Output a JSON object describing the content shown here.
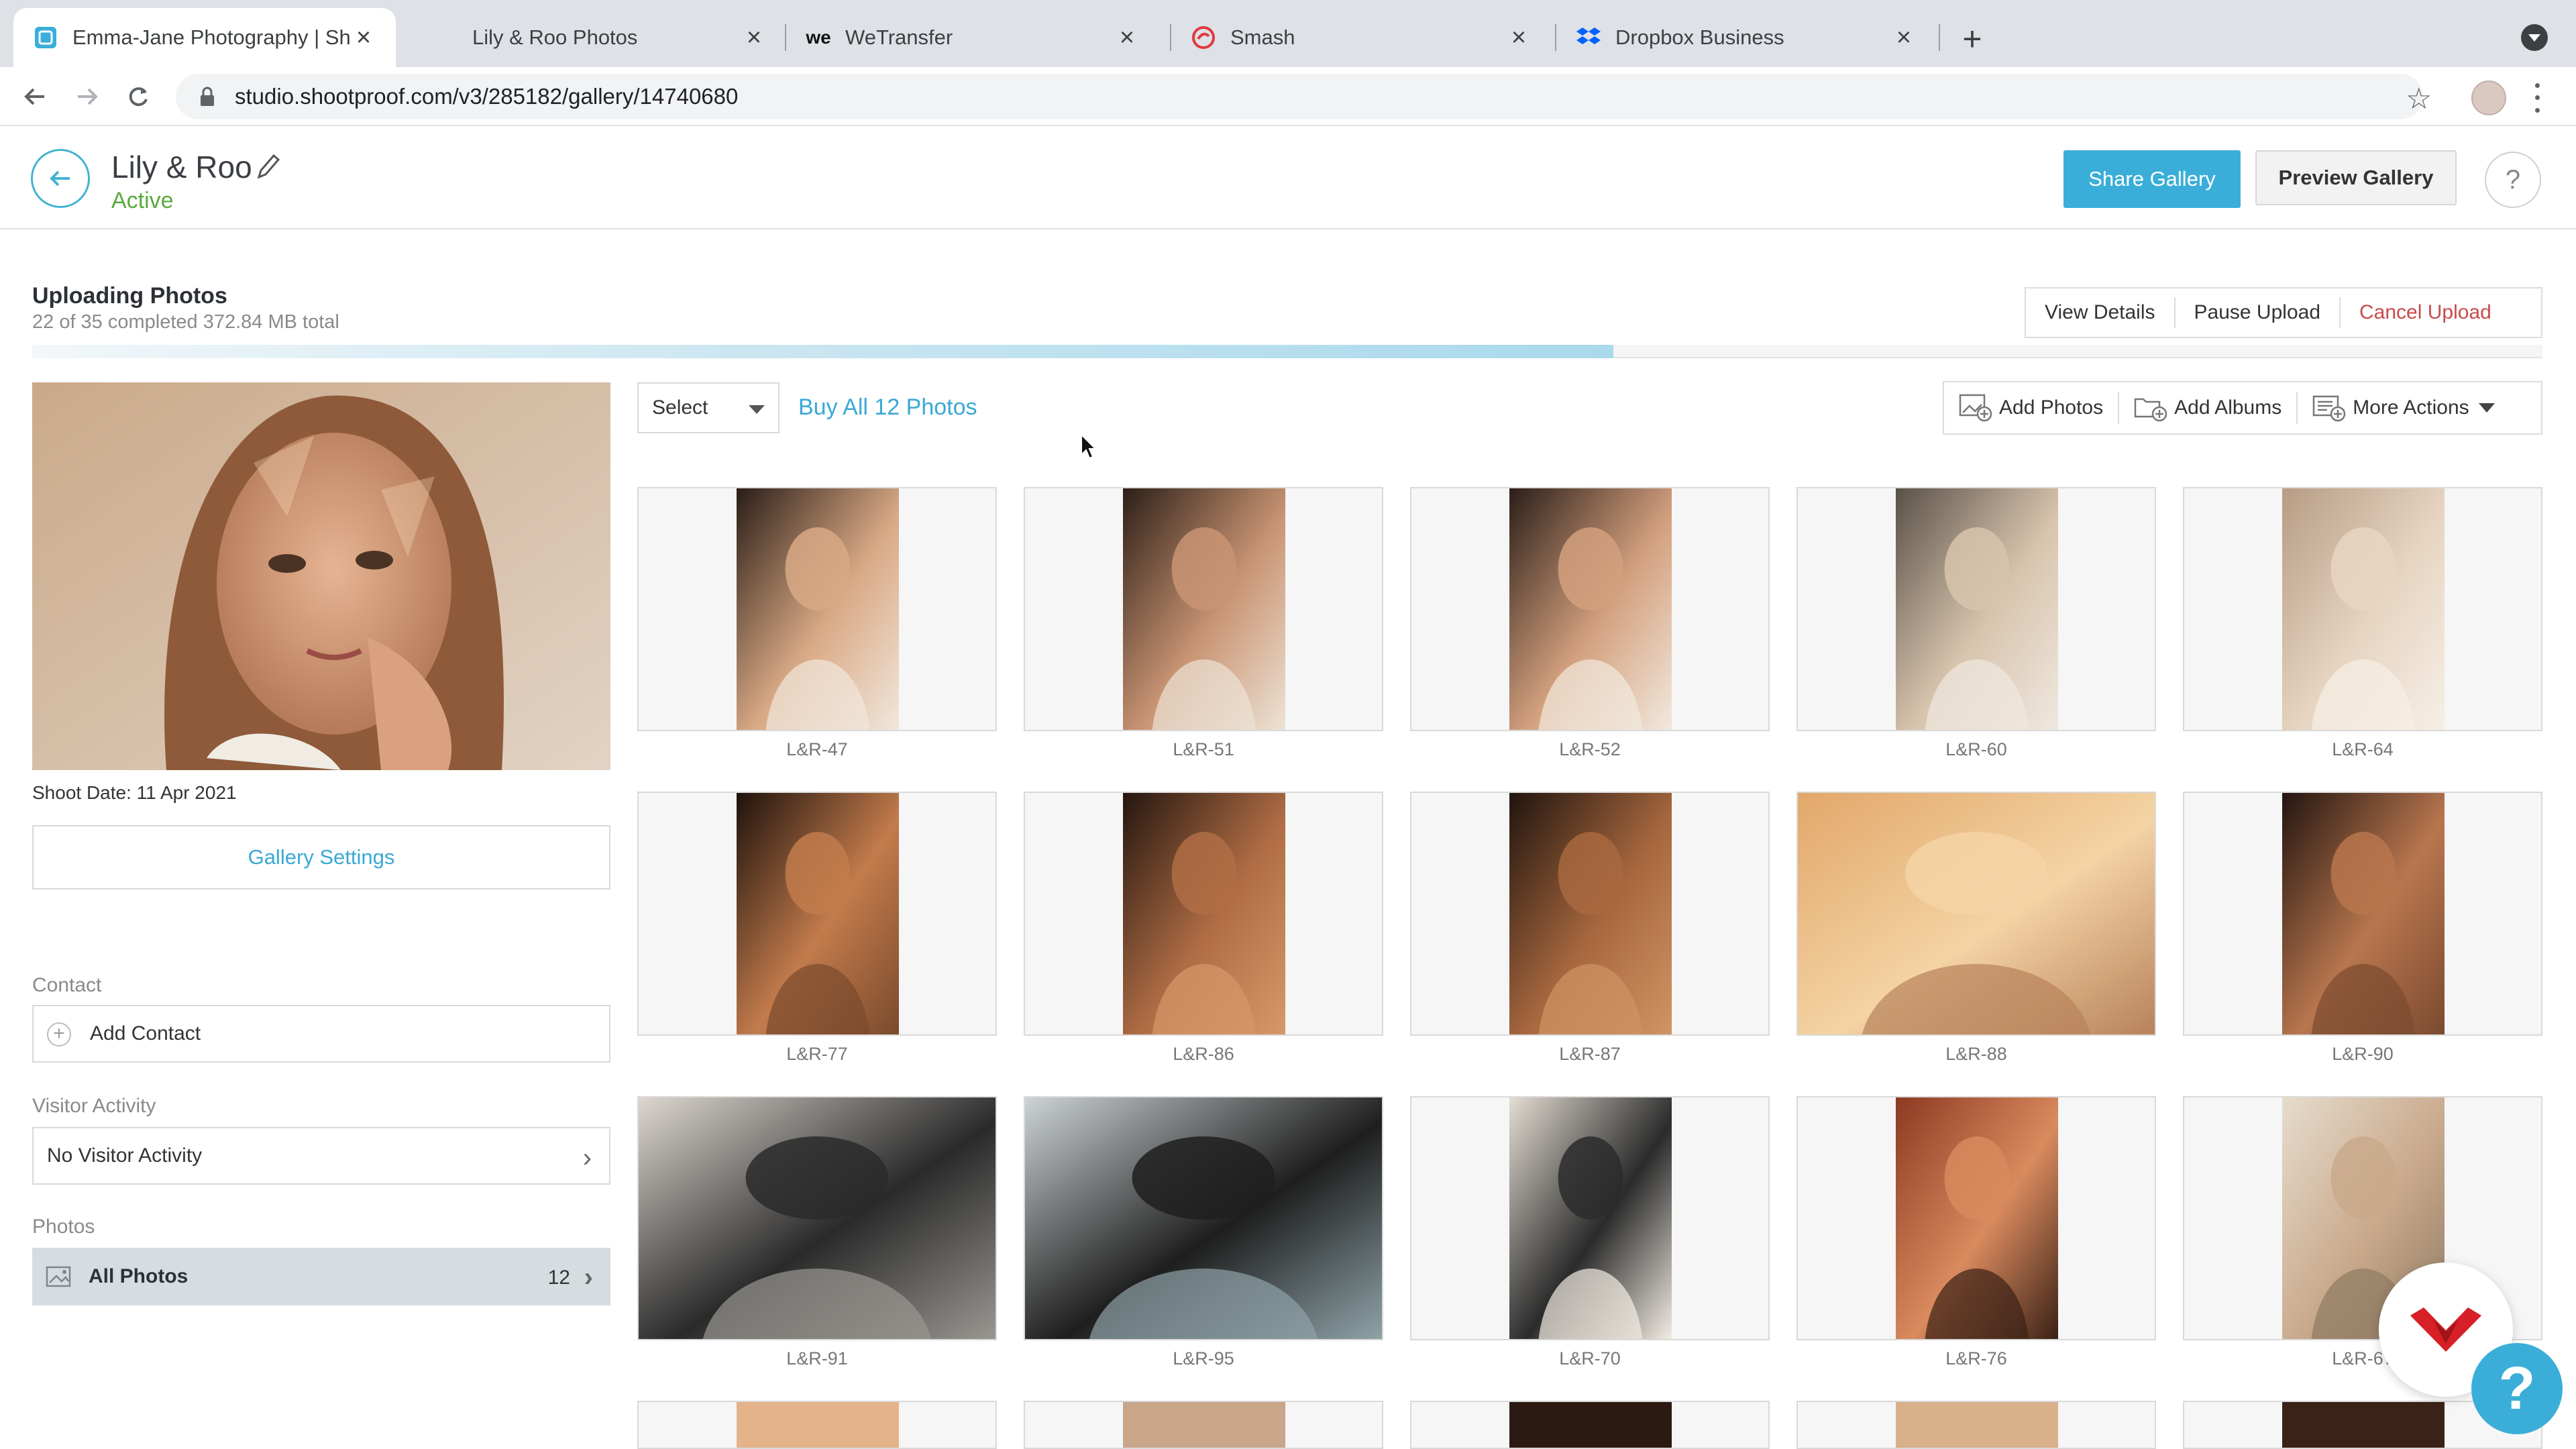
{
  "browser": {
    "tabs": [
      {
        "title": "Emma-Jane Photography | Sho",
        "favicon": "shootproof-icon"
      },
      {
        "title": "Lily & Roo Photos",
        "favicon": "none"
      },
      {
        "title": "WeTransfer",
        "favicon": "wetransfer-icon"
      },
      {
        "title": "Smash",
        "favicon": "smash-icon"
      },
      {
        "title": "Dropbox Business",
        "favicon": "dropbox-icon"
      }
    ],
    "url": "studio.shootproof.com/v3/285182/gallery/14740680"
  },
  "header": {
    "gallery_title": "Lily & Roo",
    "status": "Active",
    "share_label": "Share Gallery",
    "preview_label": "Preview Gallery",
    "help_label": "?"
  },
  "upload": {
    "title": "Uploading Photos",
    "summary": "22 of 35 completed 372.84 MB total",
    "progress": 0.63,
    "actions": [
      "View Details",
      "Pause Upload",
      "Cancel Upload"
    ]
  },
  "sidebar": {
    "shoot_date": "Shoot Date: 11 Apr 2021",
    "settings_label": "Gallery Settings",
    "contact_heading": "Contact",
    "add_contact": "Add Contact",
    "visitor_heading": "Visitor Activity",
    "visitor_value": "No Visitor Activity",
    "photos_heading": "Photos",
    "all_photos": "All Photos",
    "all_photos_count": "12"
  },
  "toolbar": {
    "select_label": "Select",
    "buy_all": "Buy All 12 Photos",
    "add_photos": "Add Photos",
    "add_albums": "Add Albums",
    "more_actions": "More Actions"
  },
  "photos": [
    {
      "label": "L&R-47"
    },
    {
      "label": "L&R-51"
    },
    {
      "label": "L&R-52"
    },
    {
      "label": "L&R-60"
    },
    {
      "label": "L&R-64"
    },
    {
      "label": "L&R-77"
    },
    {
      "label": "L&R-86"
    },
    {
      "label": "L&R-87"
    },
    {
      "label": "L&R-88"
    },
    {
      "label": "L&R-90"
    },
    {
      "label": "L&R-91"
    },
    {
      "label": "L&R-95"
    },
    {
      "label": "L&R-70"
    },
    {
      "label": "L&R-76"
    },
    {
      "label": "L&R-67"
    }
  ],
  "colors": {
    "accent": "#3aaed8",
    "active": "#5aa93f",
    "cancel": "#c84a4a"
  }
}
